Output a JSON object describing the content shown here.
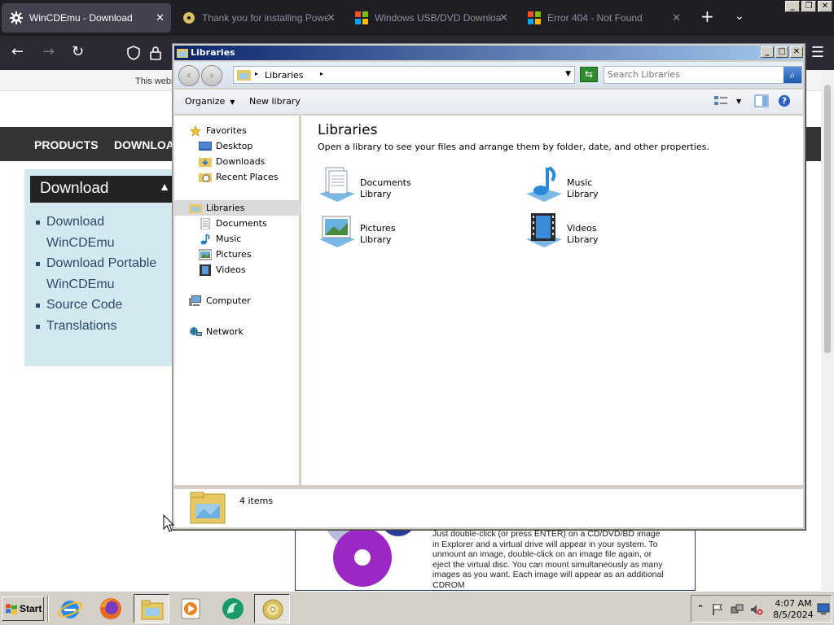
{
  "browser": {
    "tabs": [
      {
        "title": "WinCDEmu - Download",
        "active": true
      },
      {
        "title": "Thank you for installing PowerISO",
        "active": false
      },
      {
        "title": "Windows USB/DVD Download Tool",
        "active": false
      },
      {
        "title": "Error 404 - Not Found",
        "active": false
      }
    ],
    "new_tab_glyph": "+",
    "tab_list_glyph": "⌄"
  },
  "page": {
    "notice": "This website uses cookies",
    "nav": [
      "PRODUCTS",
      "DOWNLOAD"
    ],
    "sidebar": {
      "heading": "Download",
      "links": [
        {
          "line1": "Download",
          "line2": "WinCDEmu"
        },
        {
          "line1": "Download Portable",
          "line2": "WinCDEmu"
        },
        {
          "line1": "Source Code",
          "line2": ""
        },
        {
          "line1": "Translations",
          "line2": ""
        }
      ]
    },
    "promo_text": "Just double-click (or press ENTER) on a CD/DVD/BD image in Explorer and a virtual drive will appear in your system. To unmount an image, double-click on an image file again, or eject the virtual disc. You can mount simultaneously as many images as you want. Each image will appear as an additional CDROM"
  },
  "explorer": {
    "title": "Libraries",
    "address": "Libraries",
    "search_placeholder": "Search Libraries",
    "toolbar": {
      "organize": "Organize",
      "new_library": "New library"
    },
    "nav": {
      "favorites": "Favorites",
      "desktop": "Desktop",
      "downloads": "Downloads",
      "recent": "Recent Places",
      "libraries": "Libraries",
      "documents": "Documents",
      "music": "Music",
      "pictures": "Pictures",
      "videos": "Videos",
      "computer": "Computer",
      "network": "Network"
    },
    "content": {
      "title": "Libraries",
      "subtitle": "Open a library to see your files and arrange them by folder, date, and other properties.",
      "libraries": [
        {
          "name": "Documents",
          "kind": "Library",
          "icon": "documents-library-icon"
        },
        {
          "name": "Music",
          "kind": "Library",
          "icon": "music-library-icon"
        },
        {
          "name": "Pictures",
          "kind": "Library",
          "icon": "pictures-library-icon"
        },
        {
          "name": "Videos",
          "kind": "Library",
          "icon": "videos-library-icon"
        }
      ]
    },
    "status": "4 items"
  },
  "taskbar": {
    "start": "Start",
    "clock_time": "4:07 AM",
    "clock_date": "8/5/2024"
  }
}
